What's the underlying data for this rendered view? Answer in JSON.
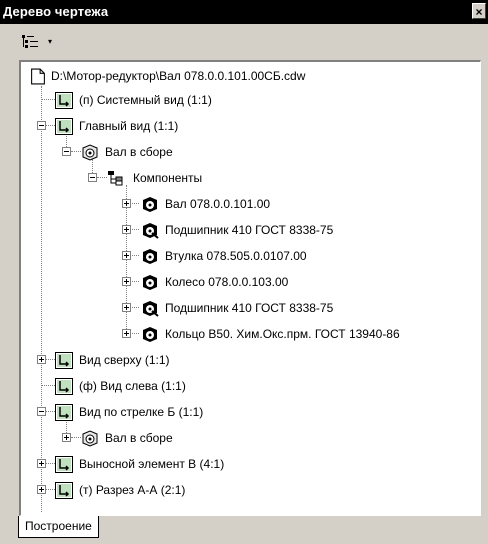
{
  "window": {
    "title": "Дерево чертежа"
  },
  "toolbar": {
    "arrow": "▾"
  },
  "tree": {
    "root": "D:\\Мотор-редуктор\\Вал 078.0.0.101.00СБ.cdw",
    "items": [
      "(п) Системный вид (1:1)",
      "Главный вид (1:1)",
      "Вал в сборе",
      "Компоненты",
      "Вал 078.0.0.101.00",
      "Подшипник 410 ГОСТ 8338-75",
      "Втулка 078.505.0.0107.00",
      "Колесо 078.0.0.103.00",
      "Подшипник 410 ГОСТ 8338-75",
      "Кольцо В50. Хим.Окс.прм. ГОСТ 13940-86",
      "Вид сверху (1:1)",
      "(ф) Вид слева (1:1)",
      "Вид по стрелке Б (1:1)",
      "Вал в сборе",
      "Выносной элемент В (4:1)",
      "(т) Разрез А-А (2:1)"
    ]
  },
  "tabs": {
    "active": "Построение"
  }
}
